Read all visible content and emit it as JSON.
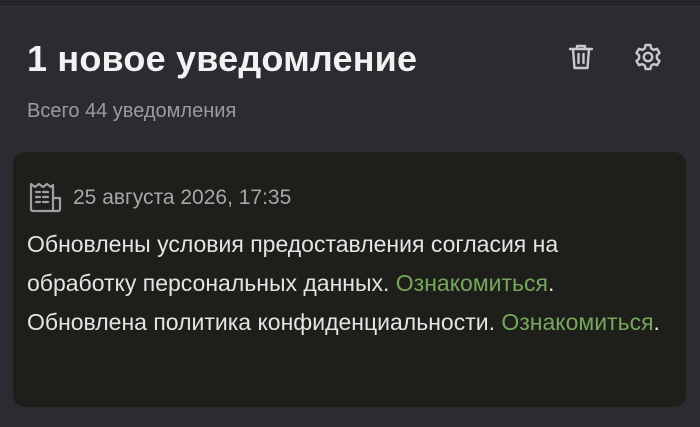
{
  "header": {
    "title": "1 новое уведомление",
    "subtitle": "Всего 44 уведомления",
    "trash_icon": "trash-icon",
    "settings_icon": "gear-icon"
  },
  "notification": {
    "icon": "document-icon",
    "date": "25 августа 2026, 17:35",
    "line1": "Обновлены условия предоставления согласия на обработку персональных данных. ",
    "link1": "Ознакомиться",
    "period1": ".",
    "line2": "Обновлена политика конфиденциальности. ",
    "link2": "Ознакомиться",
    "period2": "."
  },
  "colors": {
    "background": "#2b2c31",
    "card": "#1e1e1b",
    "link": "#77a75c",
    "text": "#e4e4e4",
    "muted": "#9a9ba0"
  }
}
